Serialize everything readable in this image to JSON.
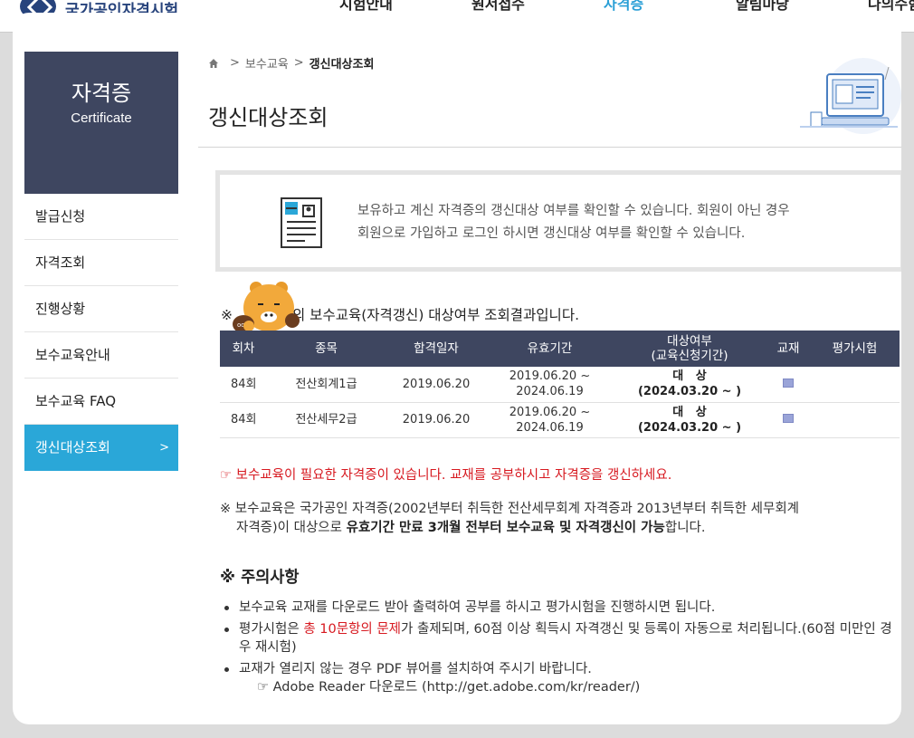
{
  "site": {
    "logo_text": "국가공인자격시험",
    "nav": [
      "시험안내",
      "원서접수",
      "자격증",
      "알림마당",
      "나의수험정보"
    ]
  },
  "sidebar": {
    "title": "자격증",
    "subtitle": "Certificate",
    "items": [
      {
        "label": "발급신청"
      },
      {
        "label": "자격조회"
      },
      {
        "label": "진행상황"
      },
      {
        "label": "보수교육안내"
      },
      {
        "label": "보수교육 FAQ"
      },
      {
        "label": "갱신대상조회",
        "arrow": ">"
      }
    ]
  },
  "breadcrumb": {
    "sep": ">",
    "level1": "보수교육",
    "current": "갱신대상조회"
  },
  "page": {
    "title": "갱신대상조회"
  },
  "info": {
    "line1": "보유하고 계신 자격증의 갱신대상 여부를 확인할 수 있습니다. 회원이 아닌 경우",
    "line2": "회원으로 가입하고 로그인 하시면 갱신대상 여부를 확인할 수 있습니다."
  },
  "result": {
    "prefix": "※",
    "suffix": "의 보수교육(자격갱신) 대상여부 조회결과입니다.",
    "headers": {
      "round": "회차",
      "subject": "종목",
      "pass_date": "합격일자",
      "valid": "유효기간",
      "target_1": "대상여부",
      "target_2": "(교육신청기간)",
      "book": "교재",
      "exam": "평가시험"
    },
    "rows": [
      {
        "round": "84회",
        "subject": "전산회계1급",
        "pass_date": "2019.06.20",
        "valid_from": "2019.06.20 ~",
        "valid_to": "2024.06.19",
        "target": "대   상",
        "period": "(2024.03.20 ~ )",
        "exam": ""
      },
      {
        "round": "84회",
        "subject": "전산세무2급",
        "pass_date": "2019.06.20",
        "valid_from": "2019.06.20 ~",
        "valid_to": "2024.06.19",
        "target": "대   상",
        "period": "(2024.03.20 ~ )",
        "exam": ""
      }
    ]
  },
  "warning": "☞ 보수교육이 필요한 자격증이 있습니다. 교재를 공부하시고 자격증을 갱신하세요.",
  "note": {
    "line1": "※ 보수교육은 국가공인 자격증(2002년부터 취득한 전산세무회계 자격증과 2013년부터 취득한 세무회계",
    "line2_a": "자격증)이 대상으로 ",
    "line2_b": "유효기간 만료 3개월 전부터 보수교육 및 자격갱신이 가능",
    "line2_c": "합니다."
  },
  "caution": {
    "title": "※ 주의사항",
    "item1": "보수교육 교재를 다운로드 받아 출력하여 공부를 하시고 평가시험을 진행하시면 됩니다.",
    "item2_a": "평가시험은 ",
    "item2_b": "총 10문항의 문제",
    "item2_c": "가 출제되며, 60점 이상 획득시 자격갱신 및 등록이 자동으로 처리됩니다.(60점 미만인 경우 재시험)",
    "item3": "교재가 열리지 않는 경우 PDF 뷰어를 설치하여 주시기 바랍니다.",
    "adobe": "☞ Adobe Reader 다운로드 (http://get.adobe.com/kr/reader/)"
  },
  "colors": {
    "sidebar_head": "#3e4660",
    "active": "#2aa7d8",
    "table_head": "#3e4660",
    "warning": "#d71920"
  }
}
